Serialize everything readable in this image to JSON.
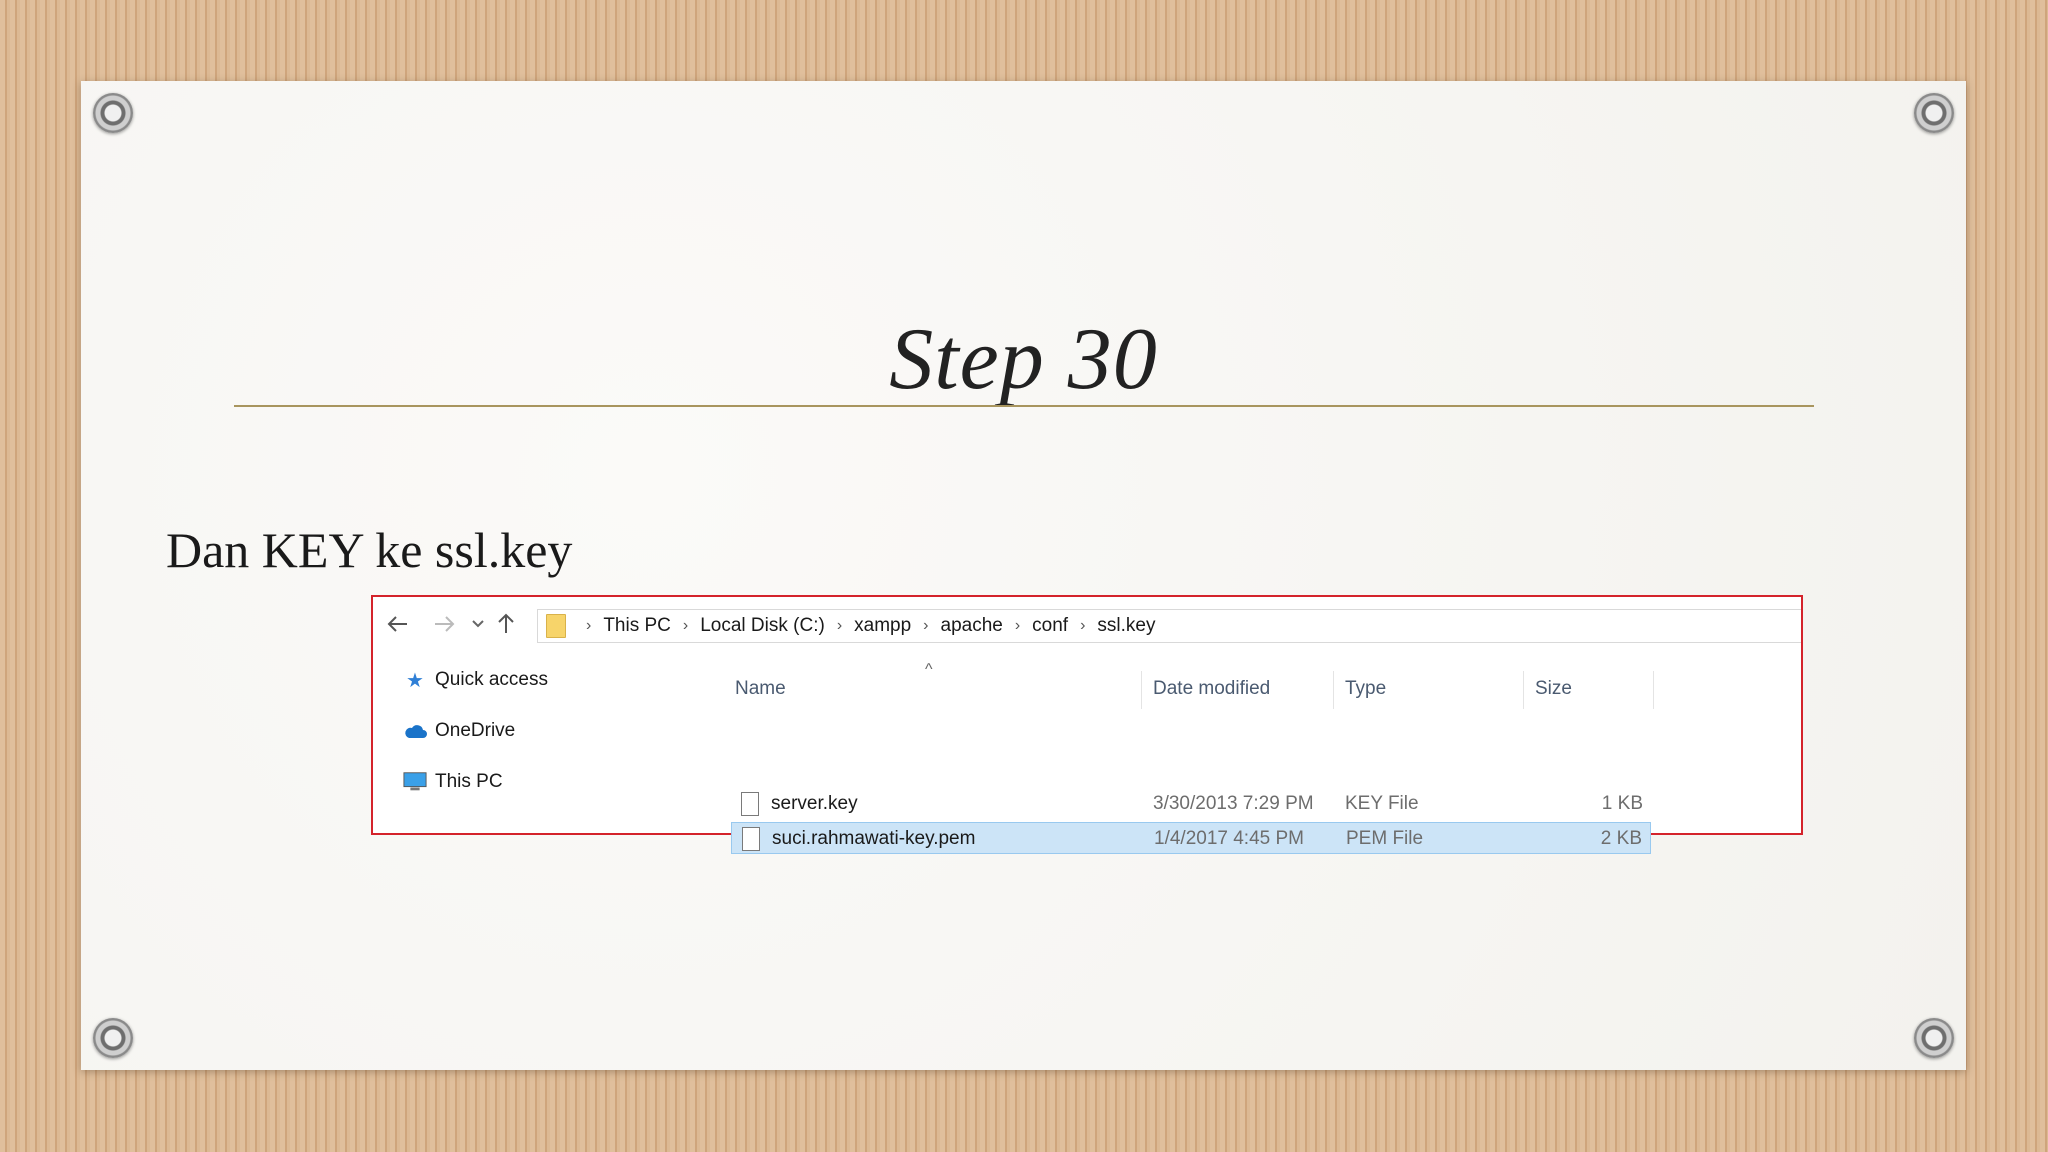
{
  "slide": {
    "title": "Step 30",
    "body": "Dan KEY ke ssl.key"
  },
  "explorer": {
    "nav": {
      "back_icon": "arrow-left-icon",
      "forward_icon": "arrow-right-icon",
      "recent_icon": "chevron-down-icon",
      "up_icon": "arrow-up-icon"
    },
    "breadcrumb": [
      "This PC",
      "Local Disk (C:)",
      "xampp",
      "apache",
      "conf",
      "ssl.key"
    ],
    "sidebar": [
      {
        "label": "Quick access",
        "icon": "star-icon"
      },
      {
        "label": "OneDrive",
        "icon": "cloud-icon"
      },
      {
        "label": "This PC",
        "icon": "computer-icon"
      }
    ],
    "columns": {
      "name": "Name",
      "date": "Date modified",
      "type": "Type",
      "size": "Size"
    },
    "files": [
      {
        "name": "server.key",
        "date": "3/30/2013 7:29 PM",
        "type": "KEY File",
        "size": "1 KB",
        "selected": false
      },
      {
        "name": "suci.rahmawati-key.pem",
        "date": "1/4/2017 4:45 PM",
        "type": "PEM File",
        "size": "2 KB",
        "selected": true
      }
    ]
  },
  "colors": {
    "highlight_box": "#d4232b",
    "selection": "#cce4f7",
    "rule": "#a8955e"
  }
}
